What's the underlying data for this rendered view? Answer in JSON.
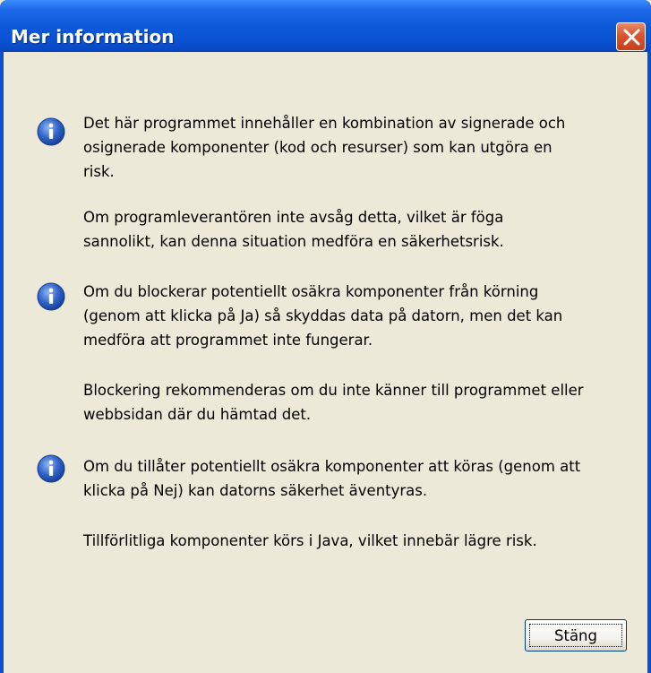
{
  "window": {
    "title": "Mer information",
    "close_icon": "close-icon"
  },
  "sections": [
    {
      "icon": "info-icon",
      "paragraphs": [
        "Det här programmet innehåller en kombination av signerade och\nosignerade komponenter (kod och resurser) som kan utgöra en\nrisk.",
        "Om programleverantören inte avsåg detta, vilket är föga\nsannolikt, kan denna situation medföra en säkerhetsrisk."
      ]
    },
    {
      "icon": "info-icon",
      "paragraphs": [
        "Om du blockerar potentiellt osäkra komponenter från körning\n(genom att klicka på Ja) så skyddas data på datorn, men det kan\nmedföra att programmet inte fungerar.",
        "Blockering rekommenderas om du inte känner till programmet eller\nwebbsidan där du hämtad det."
      ]
    },
    {
      "icon": "info-icon",
      "paragraphs": [
        "Om du tillåter potentiellt osäkra komponenter att köras (genom att\nklicka på Nej) kan datorns säkerhet äventyras.",
        "Tillförlitliga komponenter körs i Java, vilket innebär lägre risk."
      ]
    }
  ],
  "buttons": {
    "close_label": "Stäng"
  },
  "colors": {
    "title_bar": "#0B58D8",
    "client_bg": "#ECE9D8",
    "close_button": "#D8552F",
    "info_icon": "#2E63C8"
  }
}
